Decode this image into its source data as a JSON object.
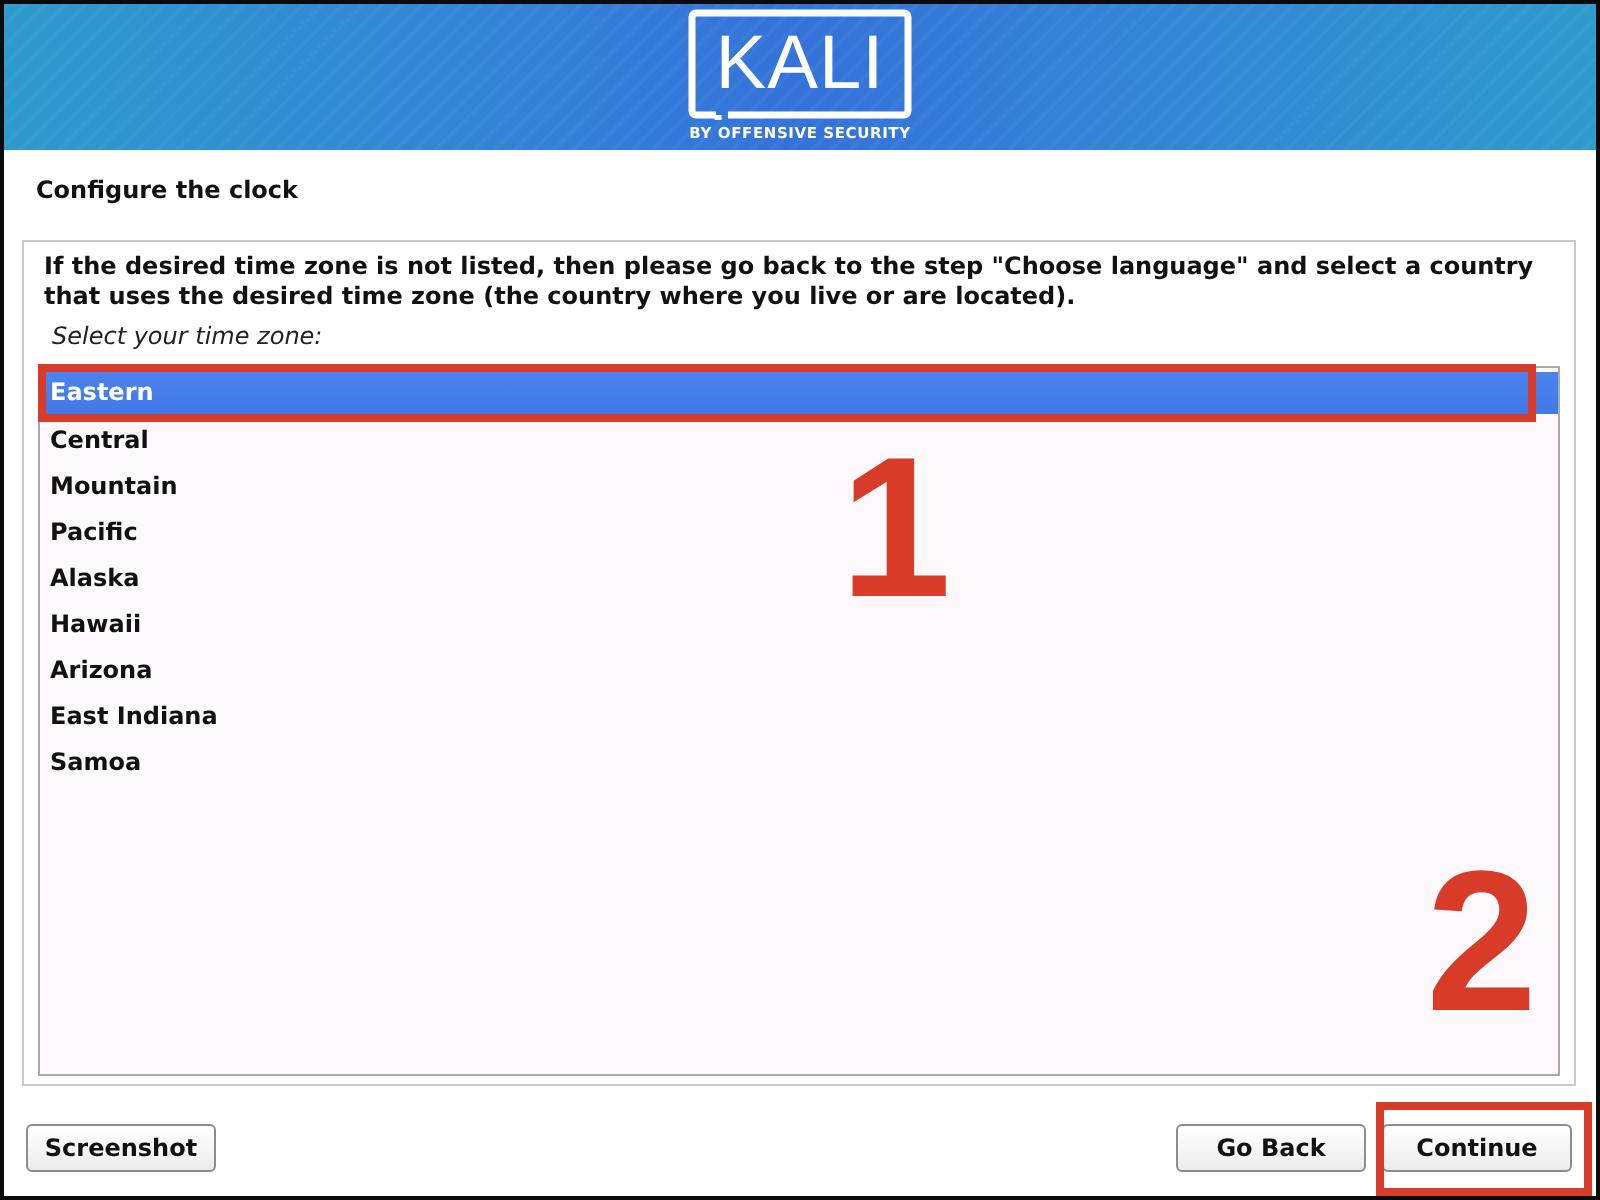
{
  "header": {
    "logo": "KALI",
    "tagline": "BY OFFENSIVE SECURITY"
  },
  "title": "Configure the clock",
  "instructions": "If the desired time zone is not listed, then please go back to the step \"Choose language\" and select a country that uses the desired time zone (the country where you live or are located).",
  "prompt": "Select your time zone:",
  "time_zones": [
    {
      "label": "Eastern",
      "selected": true,
      "callout": true
    },
    {
      "label": "Central",
      "selected": false,
      "callout": false
    },
    {
      "label": "Mountain",
      "selected": false,
      "callout": false
    },
    {
      "label": "Pacific",
      "selected": false,
      "callout": false
    },
    {
      "label": "Alaska",
      "selected": false,
      "callout": false
    },
    {
      "label": "Hawaii",
      "selected": false,
      "callout": false
    },
    {
      "label": "Arizona",
      "selected": false,
      "callout": false
    },
    {
      "label": "East Indiana",
      "selected": false,
      "callout": false
    },
    {
      "label": "Samoa",
      "selected": false,
      "callout": false
    }
  ],
  "buttons": [
    {
      "label": "Screenshot",
      "callout": false
    },
    {
      "label": "Go Back",
      "callout": false
    },
    {
      "label": "Continue",
      "callout": true
    }
  ],
  "callouts": [
    {
      "label": "1"
    },
    {
      "label": "2"
    }
  ]
}
